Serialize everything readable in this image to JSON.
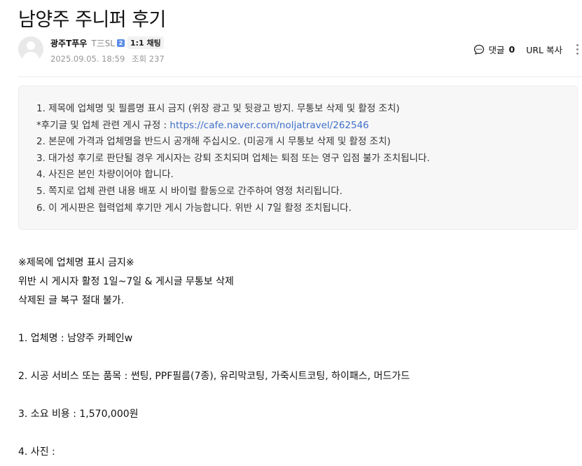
{
  "post": {
    "title": "남양주 주니퍼 후기"
  },
  "author": {
    "nickname": "광주T푸우",
    "grade": "T三SL",
    "level_badge": "2",
    "chat_label": "1:1 채팅",
    "date": "2025.09.05. 18:59",
    "views_label": "조회",
    "views": "237"
  },
  "toolbar": {
    "comment_label": "댓글",
    "comment_count": "0",
    "url_copy_label": "URL 복사"
  },
  "notice": {
    "line1": "1. 제목에 업체명 및 필름명 표시 금지 (위장 광고 및 뒷광고 방지. 무통보 삭제 및 활정 조치)",
    "line2_prefix": "*후기글 및 업체 관련 게시 규정 : ",
    "line2_link": "https://cafe.naver.com/noljatravel/262546",
    "line3": "2. 본문에 가격과 업체명을 반드시 공개해 주십시오. (미공개 시 무통보 삭제 및 활정 조치)",
    "line4": "3. 대가성 후기로 판단될 경우 게시자는 강퇴 조치되며 업체는 퇴점 또는 영구 입점 불가 조치됩니다.",
    "line5": "4. 사진은 본인 차량이어야 합니다.",
    "line6": "5. 쪽지로 업체 관련 내용 배포 시 바이럴 활동으로 간주하여 영정 처리됩니다.",
    "line7": "6. 이 게시판은 협력업체 후기만 게시 가능합니다. 위반 시 7일 활정 조치됩니다."
  },
  "content": {
    "warning1": "※제목에 업체명 표시 금지※",
    "warning2": "위반 시 게시자 활정 1일~7일 & 게시글 무통보 삭제",
    "warning3": "삭제된 글 복구 절대 불가.",
    "item1": "1. 업체명 :  남양주 카페인w",
    "item2": "2. 시공 서비스 또는 품목 :  썬팅, PPF필름(7종), 유리막코팅, 가죽시트코팅, 하이패스, 머드가드",
    "item3": "3. 소요 비용 :  1,570,000원",
    "item4": "4. 사진 :"
  },
  "icons": {
    "comment": "comment-icon",
    "more": "more-vertical-icon",
    "avatar": "default-avatar-icon"
  },
  "colors": {
    "link": "#3f70c9",
    "notice_bg": "#f7f7f7",
    "level_badge": "#5b8de8",
    "meta_text": "#979797"
  }
}
